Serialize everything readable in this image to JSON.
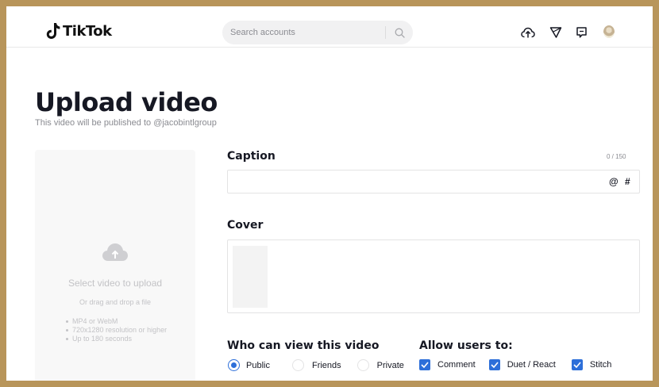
{
  "header": {
    "logo_text": "TikTok",
    "search_placeholder": "Search accounts",
    "icons": [
      "search-icon",
      "upload-cloud-icon",
      "inbox-filter-icon",
      "message-icon",
      "avatar"
    ]
  },
  "page": {
    "title": "Upload video",
    "subtitle": "This video will be published to @jacobintlgroup"
  },
  "upload": {
    "title": "Select video to upload",
    "subtitle": "Or drag and drop a file",
    "requirements": [
      "MP4 or WebM",
      "720x1280 resolution or higher",
      "Up to 180 seconds"
    ]
  },
  "caption": {
    "label": "Caption",
    "counter": "0 / 150",
    "value": "",
    "mention_symbol": "@",
    "hashtag_symbol": "#"
  },
  "cover": {
    "label": "Cover"
  },
  "visibility": {
    "label": "Who can view this video",
    "options": [
      {
        "label": "Public",
        "selected": true
      },
      {
        "label": "Friends",
        "selected": false
      },
      {
        "label": "Private",
        "selected": false
      }
    ]
  },
  "allow": {
    "label": "Allow users to:",
    "options": [
      {
        "label": "Comment",
        "checked": true
      },
      {
        "label": "Duet / React",
        "checked": true
      },
      {
        "label": "Stitch",
        "checked": true
      }
    ]
  },
  "colors": {
    "accent": "#2d6fd9",
    "frame": "#b8955a",
    "text": "#161823",
    "muted": "#8a8b91"
  }
}
